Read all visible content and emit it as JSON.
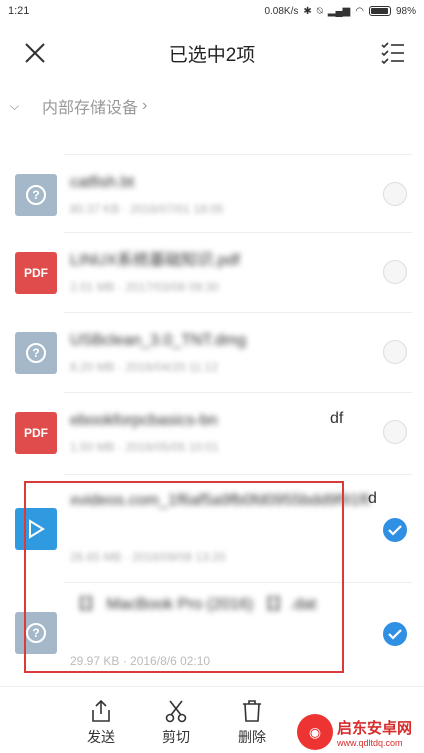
{
  "status_bar": {
    "time": "1:21",
    "speed": "0.08K/s",
    "battery": "98%"
  },
  "header": {
    "title": "已选中2项"
  },
  "breadcrumb": {
    "label": "内部存储设备"
  },
  "files": [
    {
      "icon": "unknown-file-icon",
      "name": "catfish.bt",
      "meta": "80.37 KB · 2016/07/01 18:05",
      "checked": false
    },
    {
      "icon": "pdf-file-icon",
      "pdf_label": "PDF",
      "name": "LINUX系统基础知识.pdf",
      "meta": "2.01 MB · 2017/03/08 09:30",
      "checked": false
    },
    {
      "icon": "unknown-file-icon",
      "name": "USBclean_3.0_TNT.dmg",
      "meta": "8.20 MB · 2016/04/20 11:12",
      "checked": false
    },
    {
      "icon": "pdf-file-icon",
      "pdf_label": "PDF",
      "name": "ebookforpcbasics-bn",
      "name_suffix": "df",
      "meta": "1.50 MB · 2016/05/05 10:01",
      "checked": false
    },
    {
      "icon": "video-file-icon",
      "name": "xvideos.com_1f6af5a9fb0fd0955bdd9f91f8fd45acemv",
      "name_suffix": "d",
      "meta": "26.65 MB · 2016/09/08 13:20",
      "checked": true
    },
    {
      "icon": "unknown-file-icon",
      "name": "【】 MacBook Pro (2016) 【】.dat",
      "meta": "29.97 KB · 2016/8/6 02:10",
      "checked": true
    }
  ],
  "actions": [
    {
      "label": "发送",
      "icon": "share-icon"
    },
    {
      "label": "剪切",
      "icon": "scissors-icon"
    },
    {
      "label": "删除",
      "icon": "trash-icon"
    }
  ],
  "watermark": {
    "name": "启东安卓网",
    "url": "www.qdltdq.com"
  }
}
